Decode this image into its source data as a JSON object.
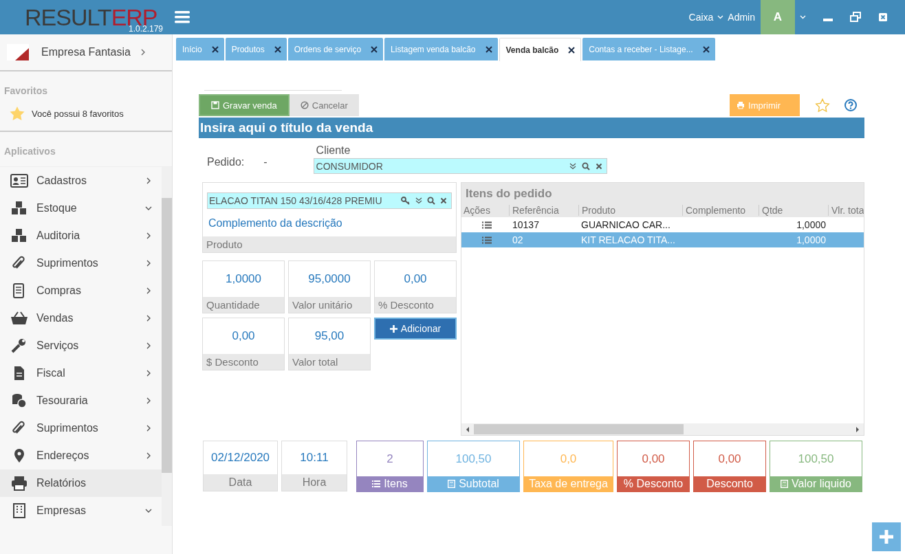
{
  "header": {
    "logo_dark": "RESULT",
    "logo_accent": "ERP",
    "version": "1.0.2.179",
    "caixa": "Caixa",
    "user": "Admin",
    "avatar": "A"
  },
  "sidebar": {
    "company": "Empresa Fantasia",
    "favorites_title": "Favoritos",
    "favorites_text": "Você possui 8 favoritos",
    "apps_title": "Aplicativos",
    "items": [
      {
        "label": "Cadastros",
        "kind": "group",
        "expanded": false,
        "selected": false
      },
      {
        "label": "Estoque",
        "kind": "group",
        "expanded": true,
        "selected": false
      },
      {
        "label": "Auditoria",
        "kind": "group",
        "expanded": false,
        "selected": false
      },
      {
        "label": "Suprimentos",
        "kind": "group",
        "expanded": false,
        "selected": false
      },
      {
        "label": "Compras",
        "kind": "group",
        "expanded": false,
        "selected": false
      },
      {
        "label": "Vendas",
        "kind": "group",
        "expanded": false,
        "selected": false
      },
      {
        "label": "Serviços",
        "kind": "group",
        "expanded": false,
        "selected": false
      },
      {
        "label": "Fiscal",
        "kind": "group",
        "expanded": false,
        "selected": false
      },
      {
        "label": "Tesouraria",
        "kind": "group",
        "expanded": false,
        "selected": false
      },
      {
        "label": "Suprimentos",
        "kind": "group",
        "expanded": false,
        "selected": false
      },
      {
        "label": "Endereços",
        "kind": "group",
        "expanded": false,
        "selected": false
      },
      {
        "label": "Relatórios",
        "kind": "link",
        "selected": true
      },
      {
        "label": "Empresas",
        "kind": "group",
        "expanded": true,
        "selected": false
      }
    ]
  },
  "tabs": [
    {
      "label": "Início",
      "selected": false
    },
    {
      "label": "Produtos",
      "selected": false
    },
    {
      "label": "Ordens de serviço",
      "selected": false
    },
    {
      "label": "Listagem venda balcão",
      "selected": false
    },
    {
      "label": "Venda balcão",
      "selected": true
    },
    {
      "label": "Contas a receber - Listage...",
      "selected": false
    }
  ],
  "toolbar": {
    "save": "Gravar venda",
    "cancel": "Cancelar",
    "print": "Imprimir"
  },
  "title": "Insira aqui o título da venda",
  "order": {
    "label": "Pedido:",
    "value": "-",
    "client_label": "Cliente",
    "client_value": "CONSUMIDOR"
  },
  "product": {
    "value": "ELACAO TITAN 150 43/16/428 PREMIU",
    "complement_link": "Complemento da descrição",
    "label": "Produto"
  },
  "fields": [
    {
      "value": "1,0000",
      "label": "Quantidade"
    },
    {
      "value": "95,0000",
      "label": "Valor unitário"
    },
    {
      "value": "0,00",
      "label": "% Desconto"
    },
    {
      "value": "0,00",
      "label": "$ Desconto"
    },
    {
      "value": "95,00",
      "label": "Valor total"
    }
  ],
  "add_button": "Adicionar",
  "items_table": {
    "title": "Itens do pedido",
    "columns": [
      "Ações",
      "Referência",
      "Produto",
      "Complemento",
      "Qtde",
      "Vlr. tota"
    ],
    "rows": [
      {
        "reference": "10137",
        "product": "GUARNICAO CAR...",
        "qty": "1,0000",
        "selected": false
      },
      {
        "reference": "02",
        "product": "KIT RELACAO TITA...",
        "qty": "1,0000",
        "selected": true
      }
    ]
  },
  "info": [
    {
      "value": "02/12/2020",
      "label": "Data"
    },
    {
      "value": "10:11",
      "label": "Hora"
    }
  ],
  "totals": [
    {
      "value": "2",
      "label": "Itens",
      "kind": "count",
      "color": "#9585bf"
    },
    {
      "value": "100,50",
      "label": "Subtotal",
      "kind": "sum",
      "color": "#6fb3e0"
    },
    {
      "value": "0,0",
      "label": "Taxa de entrega",
      "kind": "plain",
      "color": "#ffb752"
    },
    {
      "value": "0,00",
      "label": "% Desconto",
      "kind": "plain",
      "color": "#d15b47"
    },
    {
      "value": "0,00",
      "label": "Desconto",
      "kind": "plain",
      "color": "#d15b47"
    },
    {
      "value": "100,50",
      "label": "Valor liquido",
      "kind": "sum",
      "color": "#87b87f"
    }
  ]
}
